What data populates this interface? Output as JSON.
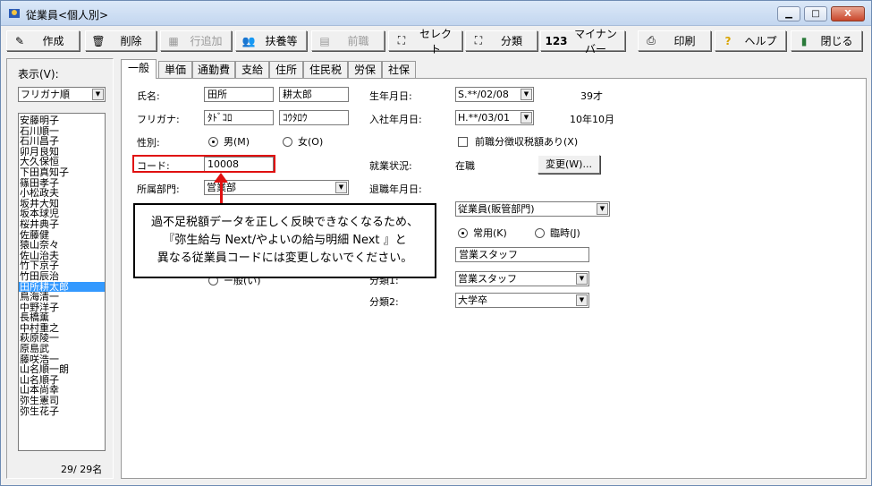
{
  "window": {
    "title": "従業員<個人別>",
    "min": "▁",
    "max": "□",
    "close": "X"
  },
  "toolbar": {
    "create": "作成",
    "delete": "削除",
    "add_row": "行追加",
    "dependents": "扶養等",
    "former": "前職",
    "select": "セレクト",
    "category": "分類",
    "mynumber": "マイナンバー",
    "print": "印刷",
    "help": "ヘルプ",
    "close": "閉じる"
  },
  "left": {
    "display_label": "表示(V):",
    "sort_value": "フリガナ順",
    "employees": [
      "安藤明子",
      "石川順一",
      "石川昌子",
      "卯月良知",
      "大久保恒",
      "下田真知子",
      "篠田孝子",
      "小松政夫",
      "坂井大知",
      "坂本球児",
      "桜井典子",
      "佐藤健",
      "猿山奈々",
      "佐山治夫",
      "竹下京子",
      "竹田辰治",
      "田所耕太郎",
      "鳥海清一",
      "中野洋子",
      "長橋薫",
      "中村重之",
      "萩原陵一",
      "原島武",
      "藤咲浩一",
      "山名順一朗",
      "山名順子",
      "山本尚幸",
      "弥生憲司",
      "弥生花子"
    ],
    "selected_index": 16,
    "count": "29/ 29名"
  },
  "tabs": [
    "一般",
    "単価",
    "通勤費",
    "支給",
    "住所",
    "住民税",
    "労保",
    "社保"
  ],
  "form": {
    "name_label": "氏名:",
    "last_name": "田所",
    "first_name": "耕太郎",
    "kana_label": "フリガナ:",
    "last_kana": "ﾀﾄﾞｺﾛ",
    "first_kana": "ｺｳﾀﾛｳ",
    "sex_label": "性別:",
    "male": "男(M)",
    "female": "女(O)",
    "code_label": "コード:",
    "code": "10008",
    "dept_label": "所属部門:",
    "dept": "営業部",
    "dob_label": "生年月日:",
    "dob": "S.**/02/08",
    "age": "39才",
    "hire_label": "入社年月日:",
    "hire": "H.**/03/01",
    "tenure": "10年10月",
    "prev_tax": "前職分徴収税額あり(X)",
    "status_label": "就業状況:",
    "status": "在職",
    "change_btn": "変更(W)...",
    "retire_label": "退職年月日:",
    "emp_type": "従業員(販管部門)",
    "regular": "常用(K)",
    "temporary": "臨時(J)",
    "job1": "営業スタッフ",
    "cat1_label": "分類1:",
    "cat1": "営業スタッフ",
    "cat2_label": "分類2:",
    "cat2": "大学卒",
    "hidden_radio": "ー般(い)"
  },
  "callout": {
    "line1": "過不足税額データを正しく反映できなくなるため、",
    "line2": "『弥生給与 Next/やよいの給与明細 Next 』と",
    "line3": "異なる従業員コードには変更しないでください。"
  },
  "colors": {
    "highlight": "#e01010",
    "selection": "#3399ff"
  }
}
